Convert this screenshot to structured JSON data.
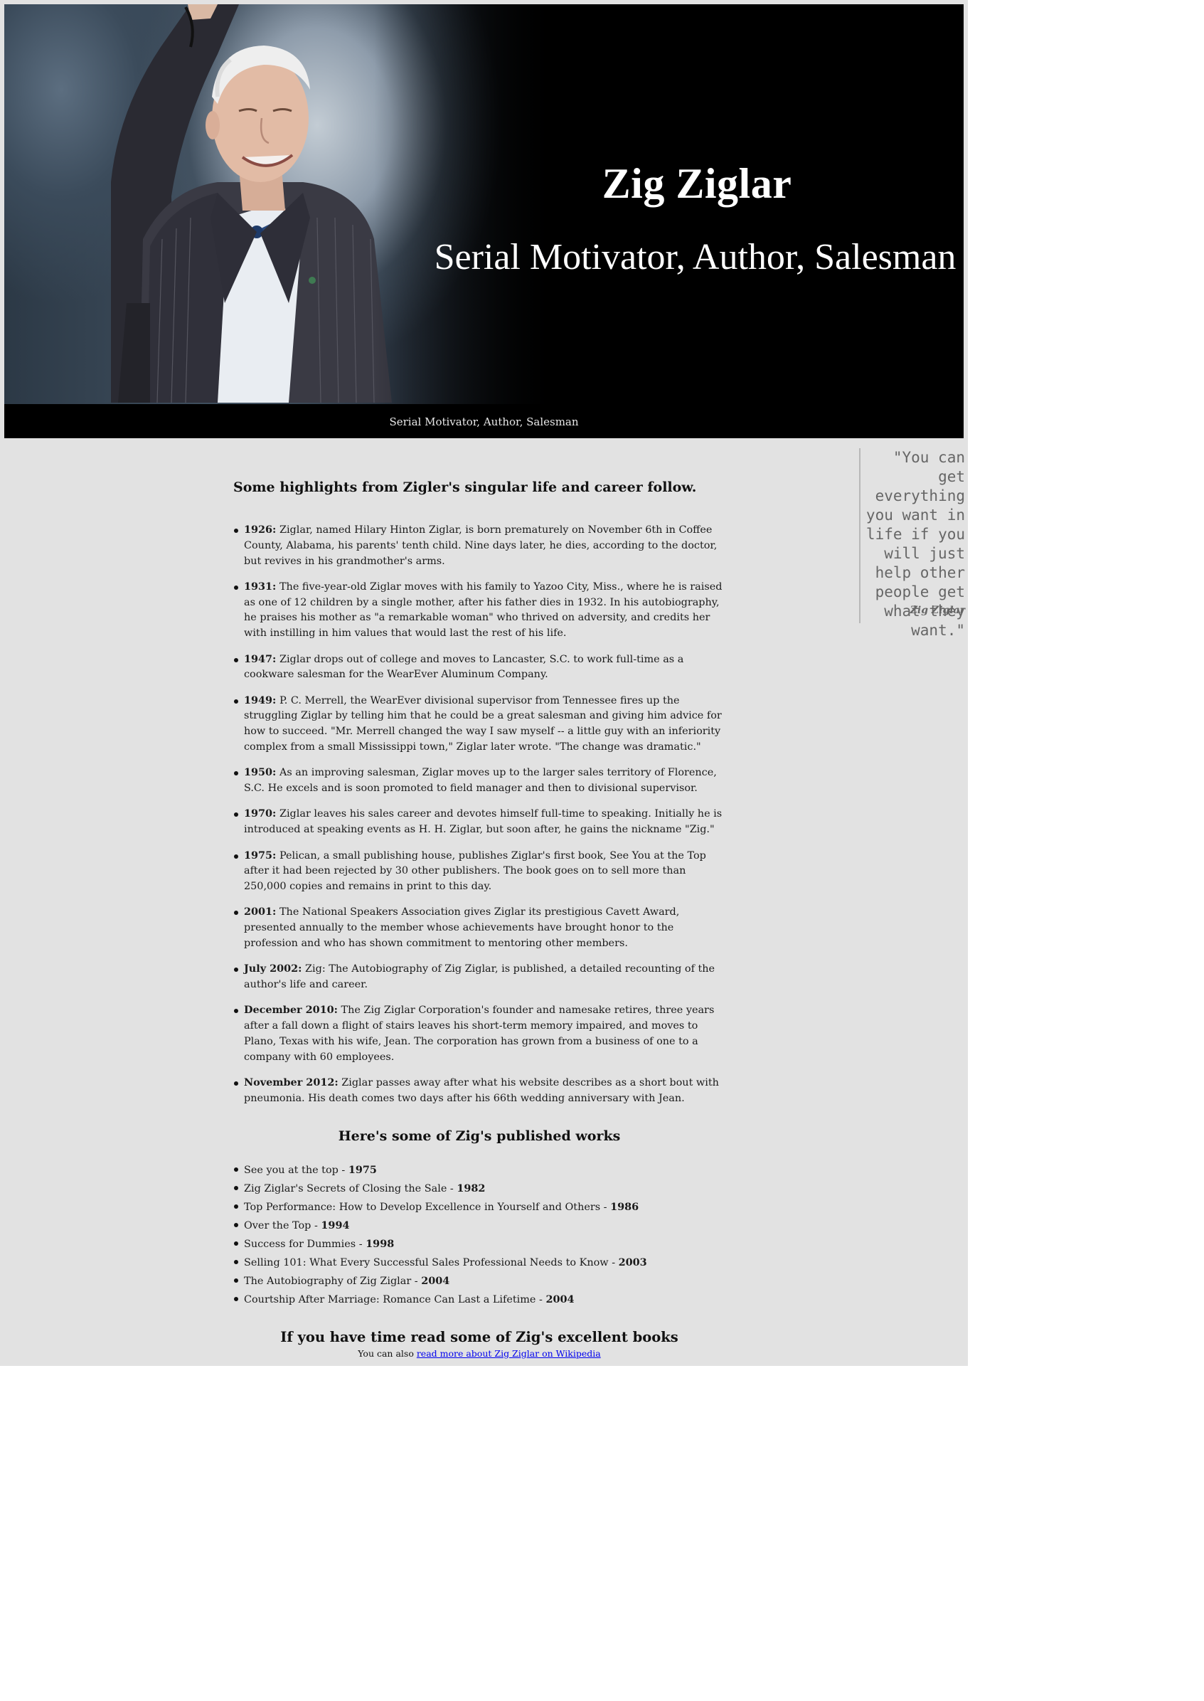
{
  "hero": {
    "title": "Zig Ziglar",
    "subtitle": "Serial Motivator, Author, Salesman",
    "caption": "Serial Motivator, Author, Salesman"
  },
  "quote": {
    "text": "\"You can get everything you want in life if you will just help other people get what they want.\"",
    "author": "Zig Ziglar"
  },
  "highlights": {
    "heading": "Some highlights from Zigler's singular life and career follow.",
    "items": [
      {
        "year": "1926:",
        "text": " Ziglar, named Hilary Hinton Ziglar, is born prematurely on November 6th in Coffee County, Alabama, his parents' tenth child. Nine days later, he dies, according to the doctor, but revives in his grandmother's arms."
      },
      {
        "year": "1931:",
        "text": " The five-year-old Ziglar moves with his family to Yazoo City, Miss., where he is raised as one of 12 children by a single mother, after his father dies in 1932. In his autobiography, he praises his mother as \"a remarkable woman\" who thrived on adversity, and credits her with instilling in him values that would last the rest of his life."
      },
      {
        "year": "1947:",
        "text": " Ziglar drops out of college and moves to Lancaster, S.C. to work full-time as a cookware salesman for the WearEver Aluminum Company."
      },
      {
        "year": "1949:",
        "text": " P. C. Merrell, the WearEver divisional supervisor from Tennessee fires up the struggling Ziglar by telling him that he could be a great salesman and giving him advice for how to succeed. \"Mr. Merrell changed the way I saw myself -- a little guy with an inferiority complex from a small Mississippi town,\" Ziglar later wrote. \"The change was dramatic.\""
      },
      {
        "year": "1950:",
        "text": " As an improving salesman, Ziglar moves up to the larger sales territory of Florence, S.C. He excels and is soon promoted to field manager and then to divisional supervisor."
      },
      {
        "year": "1970:",
        "text": " Ziglar leaves his sales career and devotes himself full-time to speaking. Initially he is introduced at speaking events as H. H. Ziglar, but soon after, he gains the nickname \"Zig.\""
      },
      {
        "year": "1975:",
        "text": " Pelican, a small publishing house, publishes Ziglar's first book, See You at the Top after it had been rejected by 30 other publishers. The book goes on to sell more than 250,000 copies and remains in print to this day."
      },
      {
        "year": "2001:",
        "text": " The National Speakers Association gives Ziglar its prestigious Cavett Award, presented annually to the member whose achievements have brought honor to the profession and who has shown commitment to mentoring other members."
      },
      {
        "year": "July 2002:",
        "text": " Zig: The Autobiography of Zig Ziglar, is published, a detailed recounting of the author's life and career."
      },
      {
        "year": "December 2010:",
        "text": " The Zig Ziglar Corporation's founder and namesake retires, three years after a fall down a flight of stairs leaves his short-term memory impaired, and moves to Plano, Texas with his wife, Jean. The corporation has grown from a business of one to a company with 60 employees."
      },
      {
        "year": "November 2012:",
        "text": " Ziglar passes away after what his website describes as a short bout with pneumonia. His death comes two days after his 66th wedding anniversary with Jean."
      }
    ]
  },
  "works": {
    "heading": "Here's some of Zig's published works",
    "items": [
      {
        "title": "See you at the top - ",
        "year": "1975"
      },
      {
        "title": "Zig Ziglar's Secrets of Closing the Sale - ",
        "year": "1982"
      },
      {
        "title": "Top Performance: How to Develop Excellence in Yourself and Others - ",
        "year": "1986"
      },
      {
        "title": "Over the Top - ",
        "year": "1994"
      },
      {
        "title": "Success for Dummies - ",
        "year": "1998"
      },
      {
        "title": "Selling 101: What Every Successful Sales Professional Needs to Know - ",
        "year": "2003"
      },
      {
        "title": "The Autobiography of Zig Ziglar - ",
        "year": "2004"
      },
      {
        "title": "Courtship After Marriage: Romance Can Last a Lifetime - ",
        "year": "2004"
      }
    ]
  },
  "footer": {
    "heading": "If you have time read some of Zig's excellent books",
    "prefix": "You can also ",
    "link_text": "read more about Zig Ziglar on Wikipedia"
  },
  "colors": {
    "page_background": "#e2e2e2",
    "hero_background": "#000000",
    "link": "#0000ee",
    "quote_text": "#666666"
  }
}
